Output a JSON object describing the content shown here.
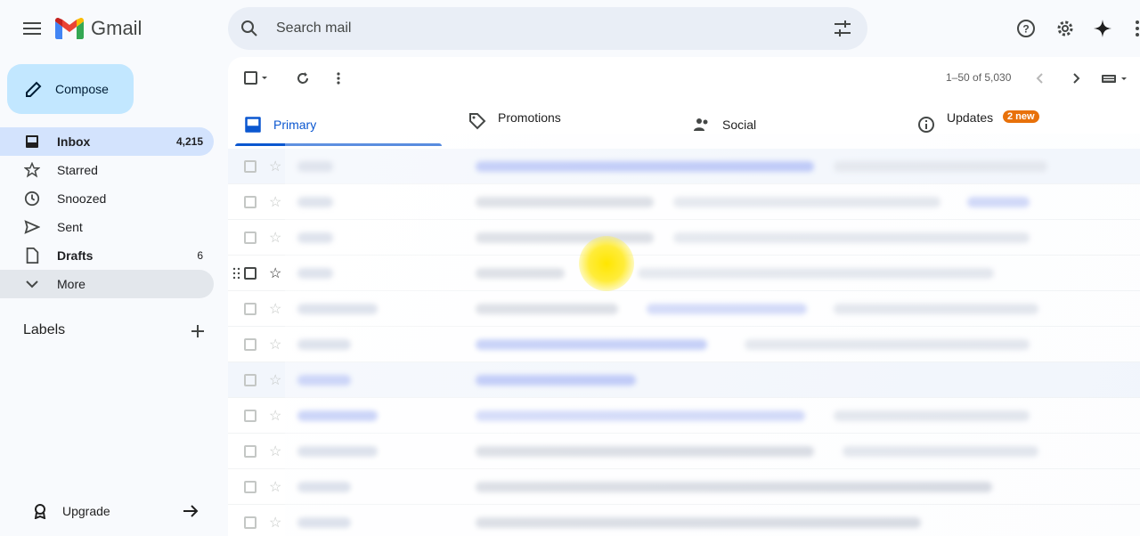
{
  "app": {
    "name": "Gmail"
  },
  "search": {
    "placeholder": "Search mail"
  },
  "compose": {
    "label": "Compose"
  },
  "sidebar": {
    "items": [
      {
        "label": "Inbox",
        "count": "4,215",
        "icon": "inbox-icon"
      },
      {
        "label": "Starred",
        "count": "",
        "icon": "star-icon"
      },
      {
        "label": "Snoozed",
        "count": "",
        "icon": "clock-icon"
      },
      {
        "label": "Sent",
        "count": "",
        "icon": "send-icon"
      },
      {
        "label": "Drafts",
        "count": "6",
        "icon": "draft-icon"
      },
      {
        "label": "More",
        "count": "",
        "icon": "chevron-down-icon"
      }
    ],
    "labels_title": "Labels",
    "upgrade_label": "Upgrade"
  },
  "toolbar": {
    "pager": "1–50 of 5,030"
  },
  "tabs": [
    {
      "label": "Primary",
      "icon": "inbox-icon"
    },
    {
      "label": "Promotions",
      "icon": "tag-icon"
    },
    {
      "label": "Social",
      "icon": "people-icon"
    },
    {
      "label": "Updates",
      "icon": "info-icon",
      "badge": "2 new"
    }
  ],
  "colors": {
    "accent": "#0b57d0",
    "compose_bg": "#c2e7ff",
    "active_nav": "#d3e3fd",
    "badge": "#e8710a"
  }
}
